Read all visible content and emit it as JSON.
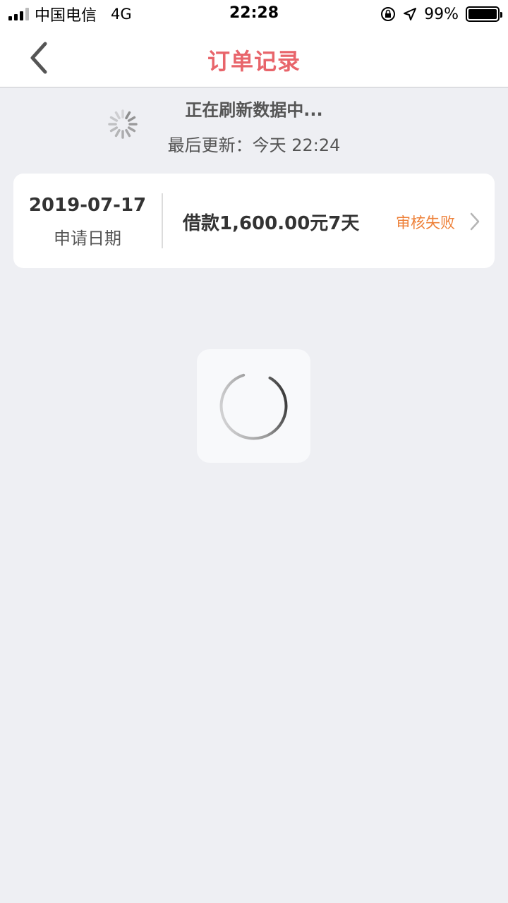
{
  "status_bar": {
    "carrier": "中国电信",
    "network": "4G",
    "time": "22:28",
    "battery": "99%",
    "battery_level": 0.99
  },
  "nav": {
    "title": "订单记录",
    "title_color": "#e8656b",
    "back_icon": "chevron-left-icon"
  },
  "refresh": {
    "status": "正在刷新数据中...",
    "last_updated": "最后更新：今天 22:24"
  },
  "orders": [
    {
      "date": "2019-07-17",
      "date_label": "申请日期",
      "summary": "借款1,600.00元7天",
      "status": "审核失败",
      "status_color": "#ee8038"
    }
  ],
  "loading": {
    "icon": "loading-spinner-icon"
  }
}
